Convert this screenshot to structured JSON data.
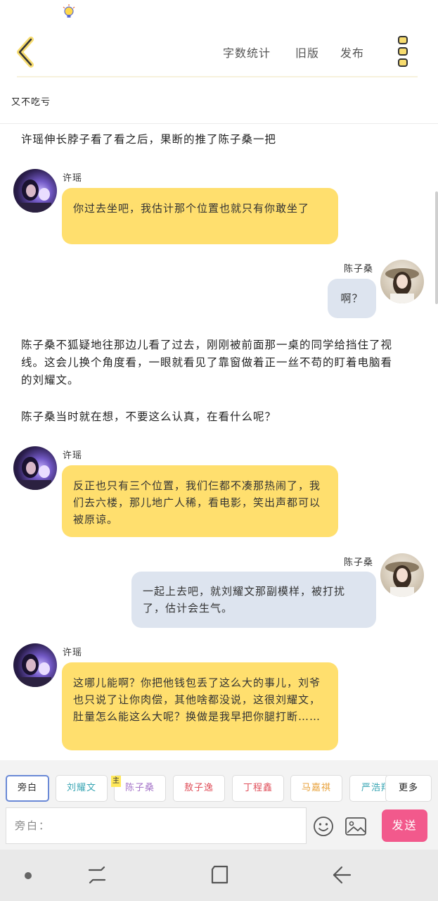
{
  "header": {
    "word_count_label": "字数统计",
    "old_version_label": "旧版",
    "publish_label": "发布"
  },
  "chapter_title": "又不吃亏",
  "colors": {
    "accent_yellow": "#ffdf6e",
    "bubble_blue": "#dde4ef",
    "send_pink": "#f2598c",
    "active_chip_border": "#6a89d6"
  },
  "messages": [
    {
      "type": "narration",
      "text": "许瑶伸长脖子看了看之后，果断的推了陈子桑一把"
    },
    {
      "type": "left",
      "speaker": "许瑶",
      "text": "你过去坐吧，我估计那个位置也就只有你敢坐了"
    },
    {
      "type": "right",
      "speaker": "陈子桑",
      "text": "啊？"
    },
    {
      "type": "narration",
      "text": "陈子桑不狐疑地往那边儿看了过去，刚刚被前面那一桌的同学给挡住了视线。这会儿换个角度看，一眼就看见了靠窗做着正一丝不苟的盯着电脑看的刘耀文。"
    },
    {
      "type": "narration",
      "text": "陈子桑当时就在想，不要这么认真，在看什么呢？"
    },
    {
      "type": "left",
      "speaker": "许瑶",
      "text": "反正也只有三个位置，我们仨都不凑那热闹了，我们去六楼，那儿地广人稀，看电影，笑出声都可以被原谅。"
    },
    {
      "type": "right",
      "speaker": "陈子桑",
      "text": "一起上去吧，就刘耀文那副模样，被打扰了，估计会生气。"
    },
    {
      "type": "left",
      "speaker": "许瑶",
      "text": "这哪儿能啊？你把他钱包丢了这么大的事儿，刘爷也只说了让你肉偿，其他啥都没说，这很刘耀文，肚量怎么能这么大呢？换做是我早把你腿打断……"
    }
  ],
  "roles": [
    {
      "label": "旁白",
      "color": "#333333"
    },
    {
      "label": "刘耀文",
      "color": "#3aa6b4"
    },
    {
      "label": "陈子桑",
      "color": "#a676c9"
    },
    {
      "label": "敖子逸",
      "color": "#e0515c"
    },
    {
      "label": "丁程鑫",
      "color": "#e0515c"
    },
    {
      "label": "马嘉祺",
      "color": "#e8a23c"
    },
    {
      "label": "严浩翔",
      "color": "#3aa6b4"
    }
  ],
  "main_badge": "主",
  "more_label": "更多",
  "input_placeholder": "旁白：",
  "send_label": "发送"
}
